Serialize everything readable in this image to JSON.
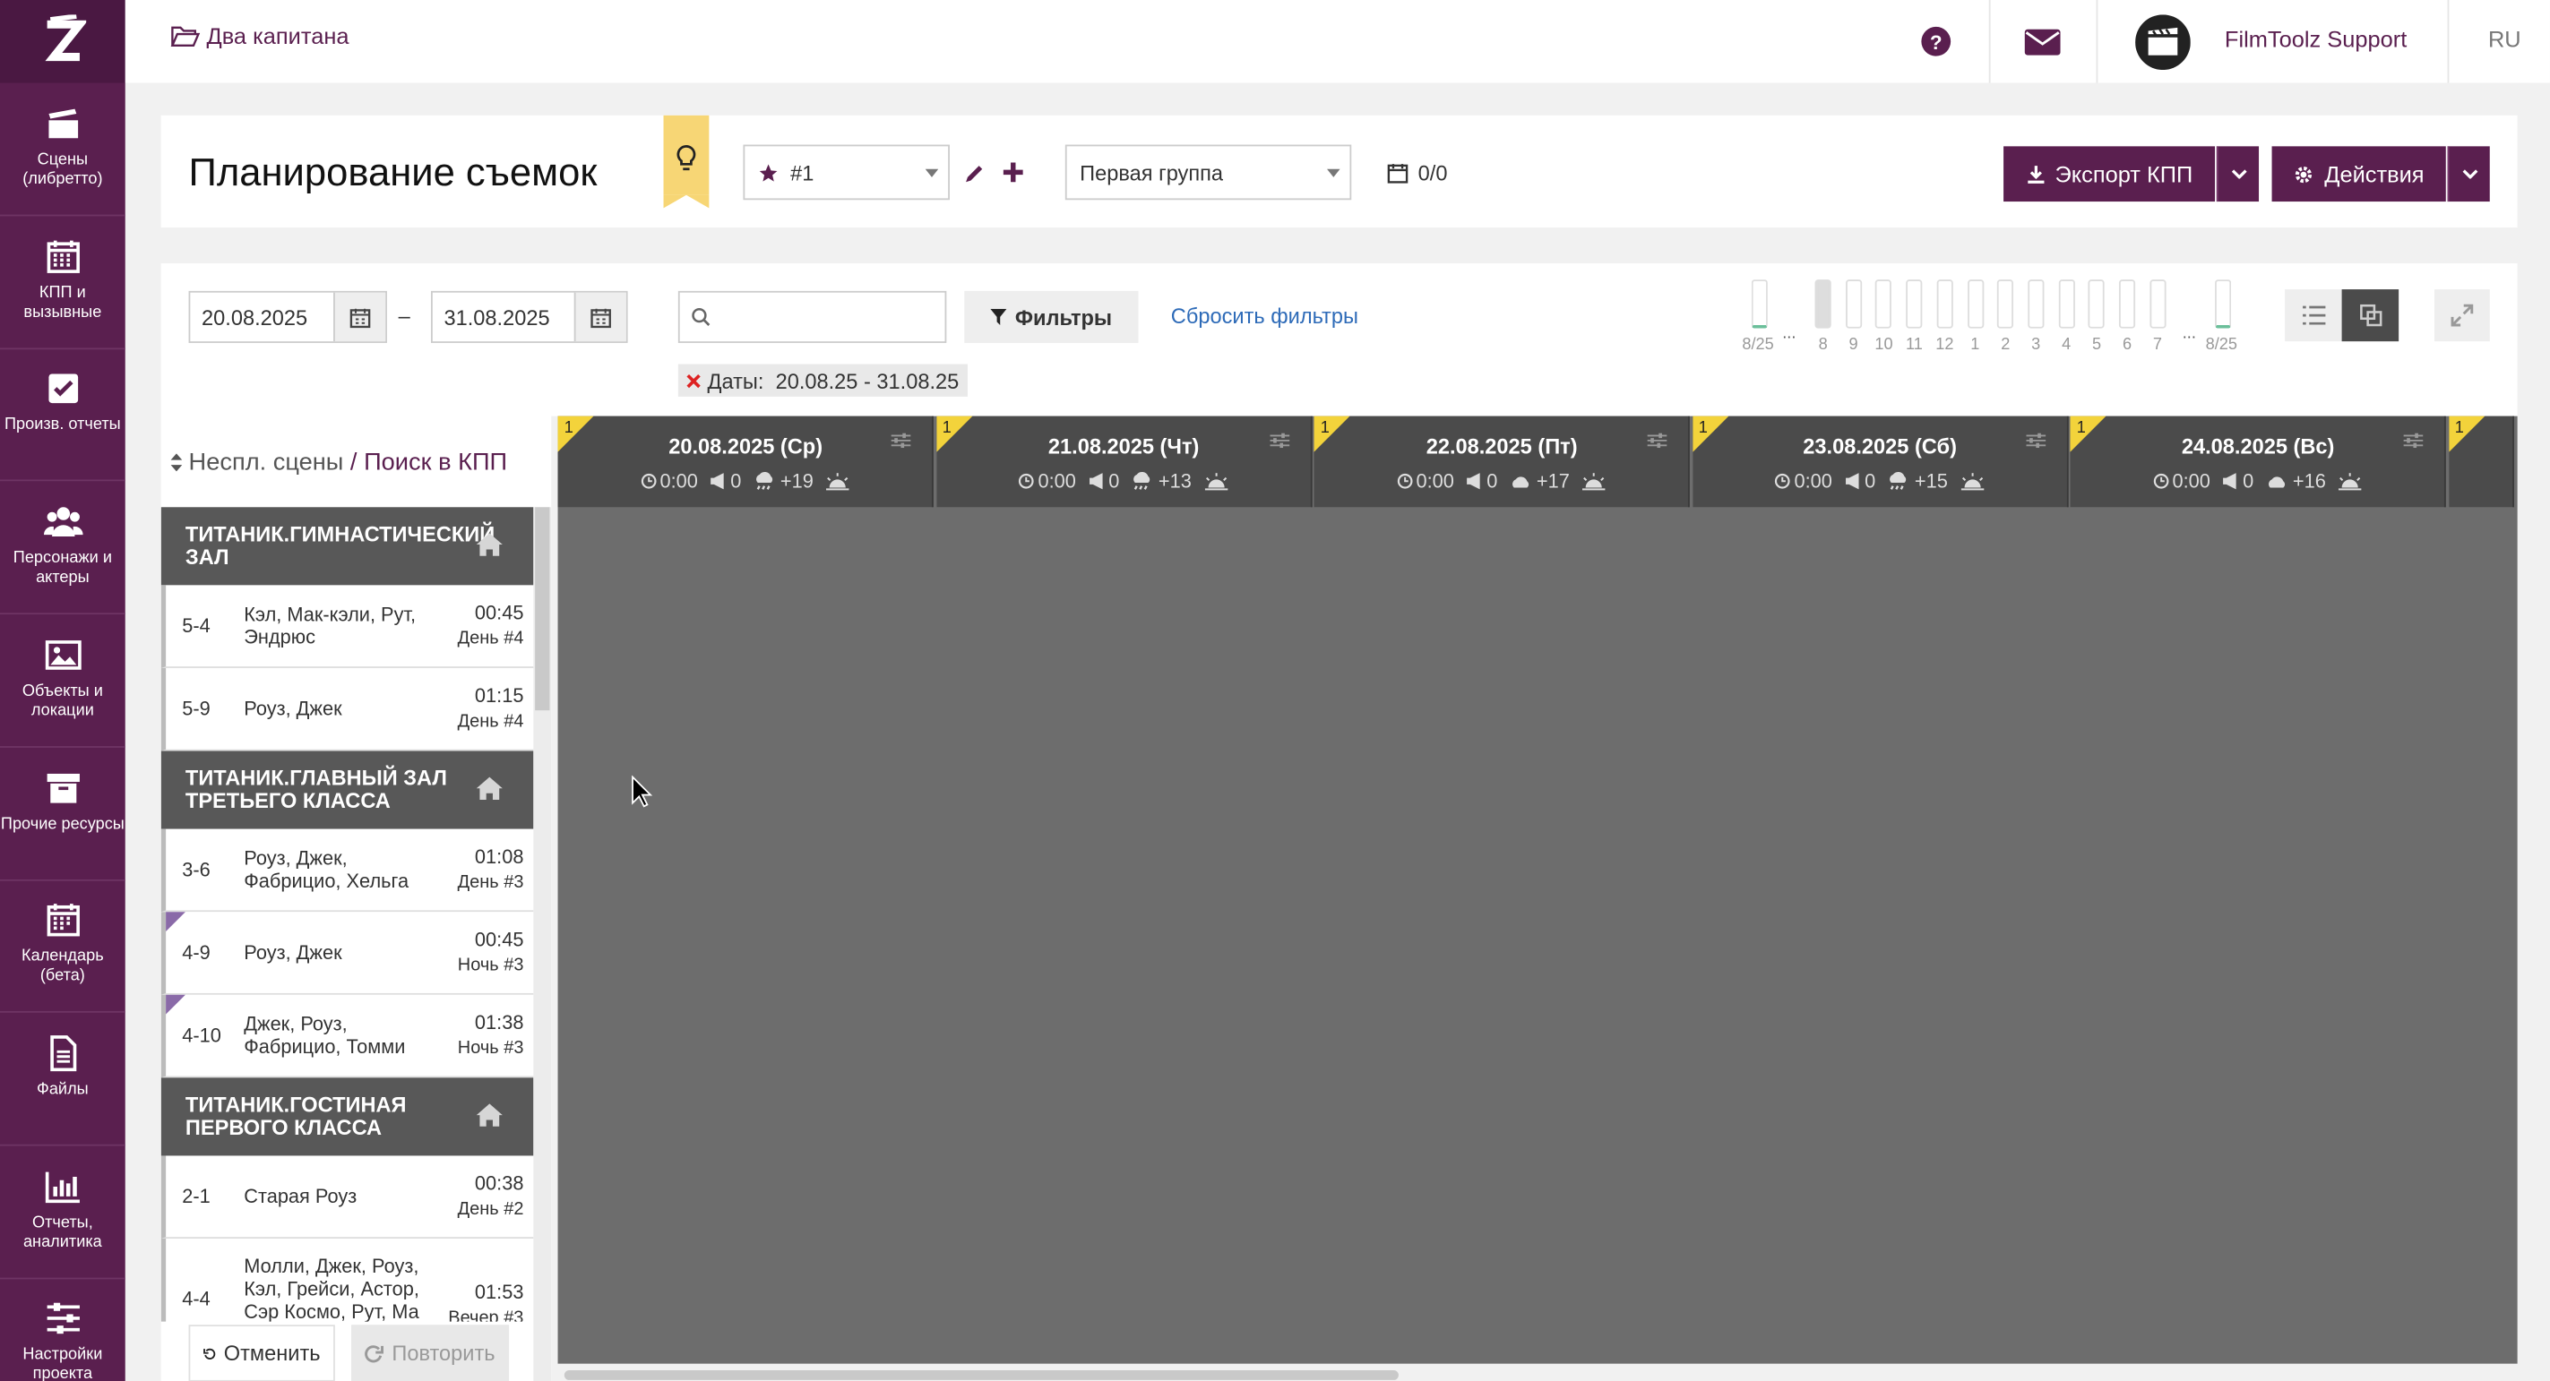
{
  "sidebar": {
    "items": [
      {
        "label": "Сцены (либретто)",
        "icon": "clapperboard-icon"
      },
      {
        "label": "КПП и вызывные",
        "icon": "calendar-grid-icon"
      },
      {
        "label": "Произв. отчеты",
        "icon": "check-square-icon"
      },
      {
        "label": "Персонажи и актеры",
        "icon": "users-icon"
      },
      {
        "label": "Объекты и локации",
        "icon": "image-icon"
      },
      {
        "label": "Прочие ресурсы",
        "icon": "archive-icon"
      },
      {
        "label": "Календарь (бета)",
        "icon": "calendar-icon"
      },
      {
        "label": "Файлы",
        "icon": "file-icon"
      },
      {
        "label": "Отчеты, аналитика",
        "icon": "bar-chart-icon"
      },
      {
        "label": "Настройки проекта",
        "icon": "sliders-icon"
      }
    ]
  },
  "topbar": {
    "project": "Два капитана",
    "user": "FilmToolz Support",
    "lang": "RU"
  },
  "header": {
    "title": "Планирование съемок",
    "variant": "#1",
    "group": "Первая группа",
    "counter": "0/0",
    "export_label": "Экспорт КПП",
    "actions_label": "Действия"
  },
  "filters": {
    "date_from": "20.08.2025",
    "date_to": "31.08.2025",
    "dash": "–",
    "search_placeholder": "",
    "filters_label": "Фильтры",
    "reset_label": "Сбросить фильтры",
    "chip_label": "Даты:",
    "chip_value": "20.08.25 - 31.08.25",
    "mini_days": [
      "8",
      "9",
      "10",
      "11",
      "12",
      "1",
      "2",
      "3",
      "4",
      "5",
      "6",
      "7"
    ],
    "mini_start": "8/25",
    "mini_end": "8/25",
    "ellipsis": "..."
  },
  "left": {
    "head_a": "Неспл. сцены",
    "head_sep": "/",
    "head_b": "Поиск в КПП",
    "groups": [
      {
        "title": "ТИТАНИК.ГИМНАСТИЧЕСКИЙ ЗАЛ",
        "rows": [
          {
            "num": "5-4",
            "names": "Кэл, Мак-кэли, Рут, Эндрюс",
            "time": "00:45",
            "day": "День #4"
          },
          {
            "num": "5-9",
            "names": "Роуз, Джек",
            "time": "01:15",
            "day": "День #4"
          }
        ]
      },
      {
        "title": "ТИТАНИК.ГЛАВНЫЙ ЗАЛ ТРЕТЬЕГО КЛАССА",
        "rows": [
          {
            "num": "3-6",
            "names": "Роуз, Джек, Фабрицио, Хельга",
            "time": "01:08",
            "day": "День #3"
          },
          {
            "num": "4-9",
            "names": "Роуз, Джек",
            "time": "00:45",
            "day": "Ночь #3"
          },
          {
            "num": "4-10",
            "names": "Джек, Роуз, Фабрицио, Томми",
            "time": "01:38",
            "day": "Ночь #3"
          }
        ]
      },
      {
        "title": "ТИТАНИК.ГОСТИНАЯ ПЕРВОГО КЛАССА",
        "rows": [
          {
            "num": "2-1",
            "names": "Старая Роуз",
            "time": "00:38",
            "day": "День #2"
          },
          {
            "num": "4-4",
            "names": "Молли, Джек, Роуз, Кэл, Грейси, Астор, Сэр Космо, Рут, Ма",
            "time": "01:53",
            "day": "Вечер #3"
          }
        ]
      }
    ]
  },
  "undo": {
    "undo_label": "Отменить",
    "redo_label": "Повторить"
  },
  "days": [
    {
      "date": "20.08.2025 (Ср)",
      "dur": "0:00",
      "ads": "0",
      "temp": "+19",
      "weather": "rain-cloud-icon",
      "flag": "1"
    },
    {
      "date": "21.08.2025 (Чт)",
      "dur": "0:00",
      "ads": "0",
      "temp": "+13",
      "weather": "rain-cloud-icon",
      "flag": "1"
    },
    {
      "date": "22.08.2025 (Пт)",
      "dur": "0:00",
      "ads": "0",
      "temp": "+17",
      "weather": "cloud-icon",
      "flag": "1"
    },
    {
      "date": "23.08.2025 (Сб)",
      "dur": "0:00",
      "ads": "0",
      "temp": "+15",
      "weather": "rain-cloud-icon",
      "flag": "1"
    },
    {
      "date": "24.08.2025 (Вс)",
      "dur": "0:00",
      "ads": "0",
      "temp": "+16",
      "weather": "cloud-icon",
      "flag": "1"
    }
  ],
  "colors": {
    "brand": "#5a1f4f",
    "flag": "#f3d33b",
    "board": "#6d6d6d"
  }
}
